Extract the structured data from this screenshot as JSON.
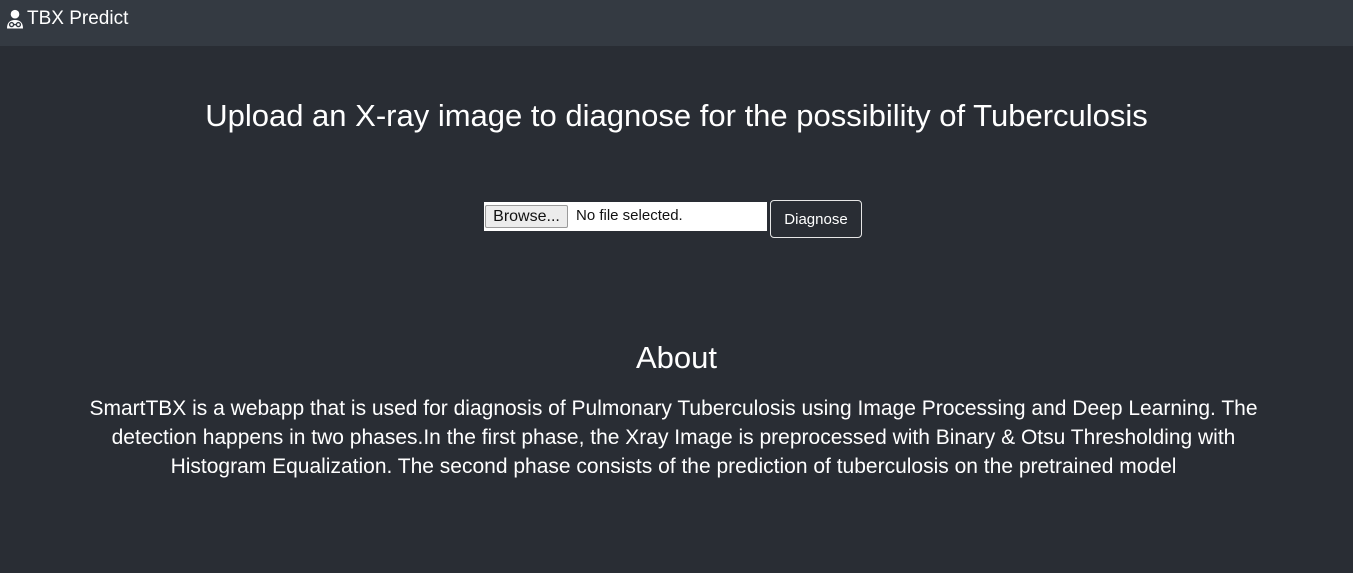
{
  "navbar": {
    "brand_icon": "user-doctor-icon",
    "brand_label": "TBX Predict"
  },
  "upload": {
    "title": "Upload an X-ray image to diagnose for the possibility of Tuberculosis",
    "browse_label": "Browse...",
    "file_status": "No file selected.",
    "diagnose_label": "Diagnose"
  },
  "about": {
    "title": "About",
    "text": "SmartTBX is a webapp that is used for diagnosis of Pulmonary Tuberculosis using Image Processing and Deep Learning. The detection happens in two phases.In the first phase, the Xray Image is preprocessed with Binary & Otsu Thresholding with Histogram Equalization. The second phase consists of the prediction of tuberculosis on the pretrained model"
  },
  "colors": {
    "background": "#292d34",
    "navbar": "#343a42",
    "text": "#ffffff"
  }
}
